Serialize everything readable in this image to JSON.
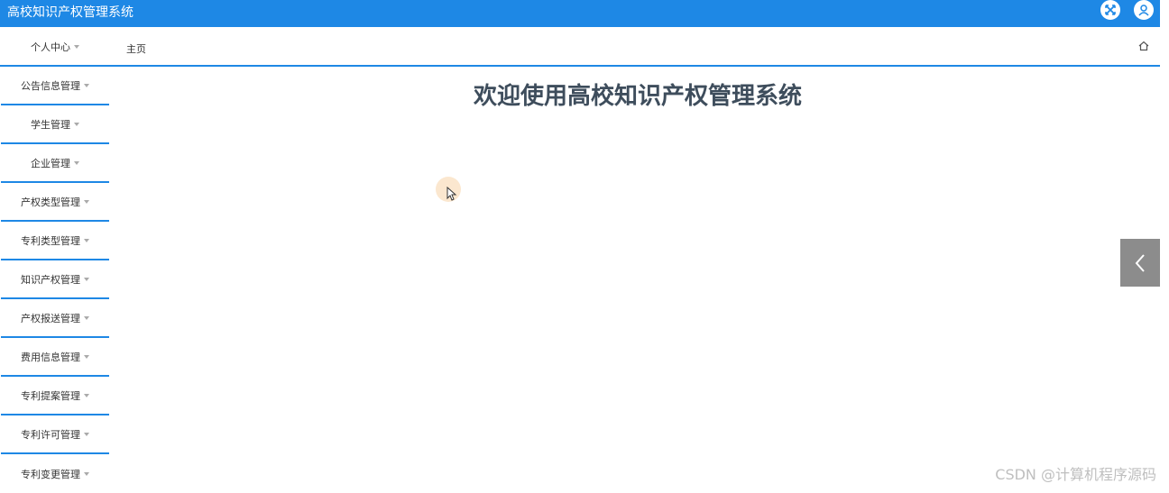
{
  "app": {
    "title": "高校知识产权管理系统"
  },
  "topbar": {
    "icons": [
      "fullscreen-icon",
      "user-icon"
    ]
  },
  "menu": {
    "personal_center": "个人中心",
    "home_tab": "主页",
    "items": [
      "公告信息管理",
      "学生管理",
      "企业管理",
      "产权类型管理",
      "专利类型管理",
      "知识产权管理",
      "产权报送管理",
      "费用信息管理",
      "专利提案管理",
      "专利许可管理",
      "专利变更管理"
    ]
  },
  "main": {
    "welcome": "欢迎使用高校知识产权管理系统"
  },
  "watermark": "CSDN @计算机程序源码",
  "colors": {
    "primary": "#1e88e5",
    "title_text": "#3e4d5c",
    "side_btn": "#8c8c8c"
  }
}
